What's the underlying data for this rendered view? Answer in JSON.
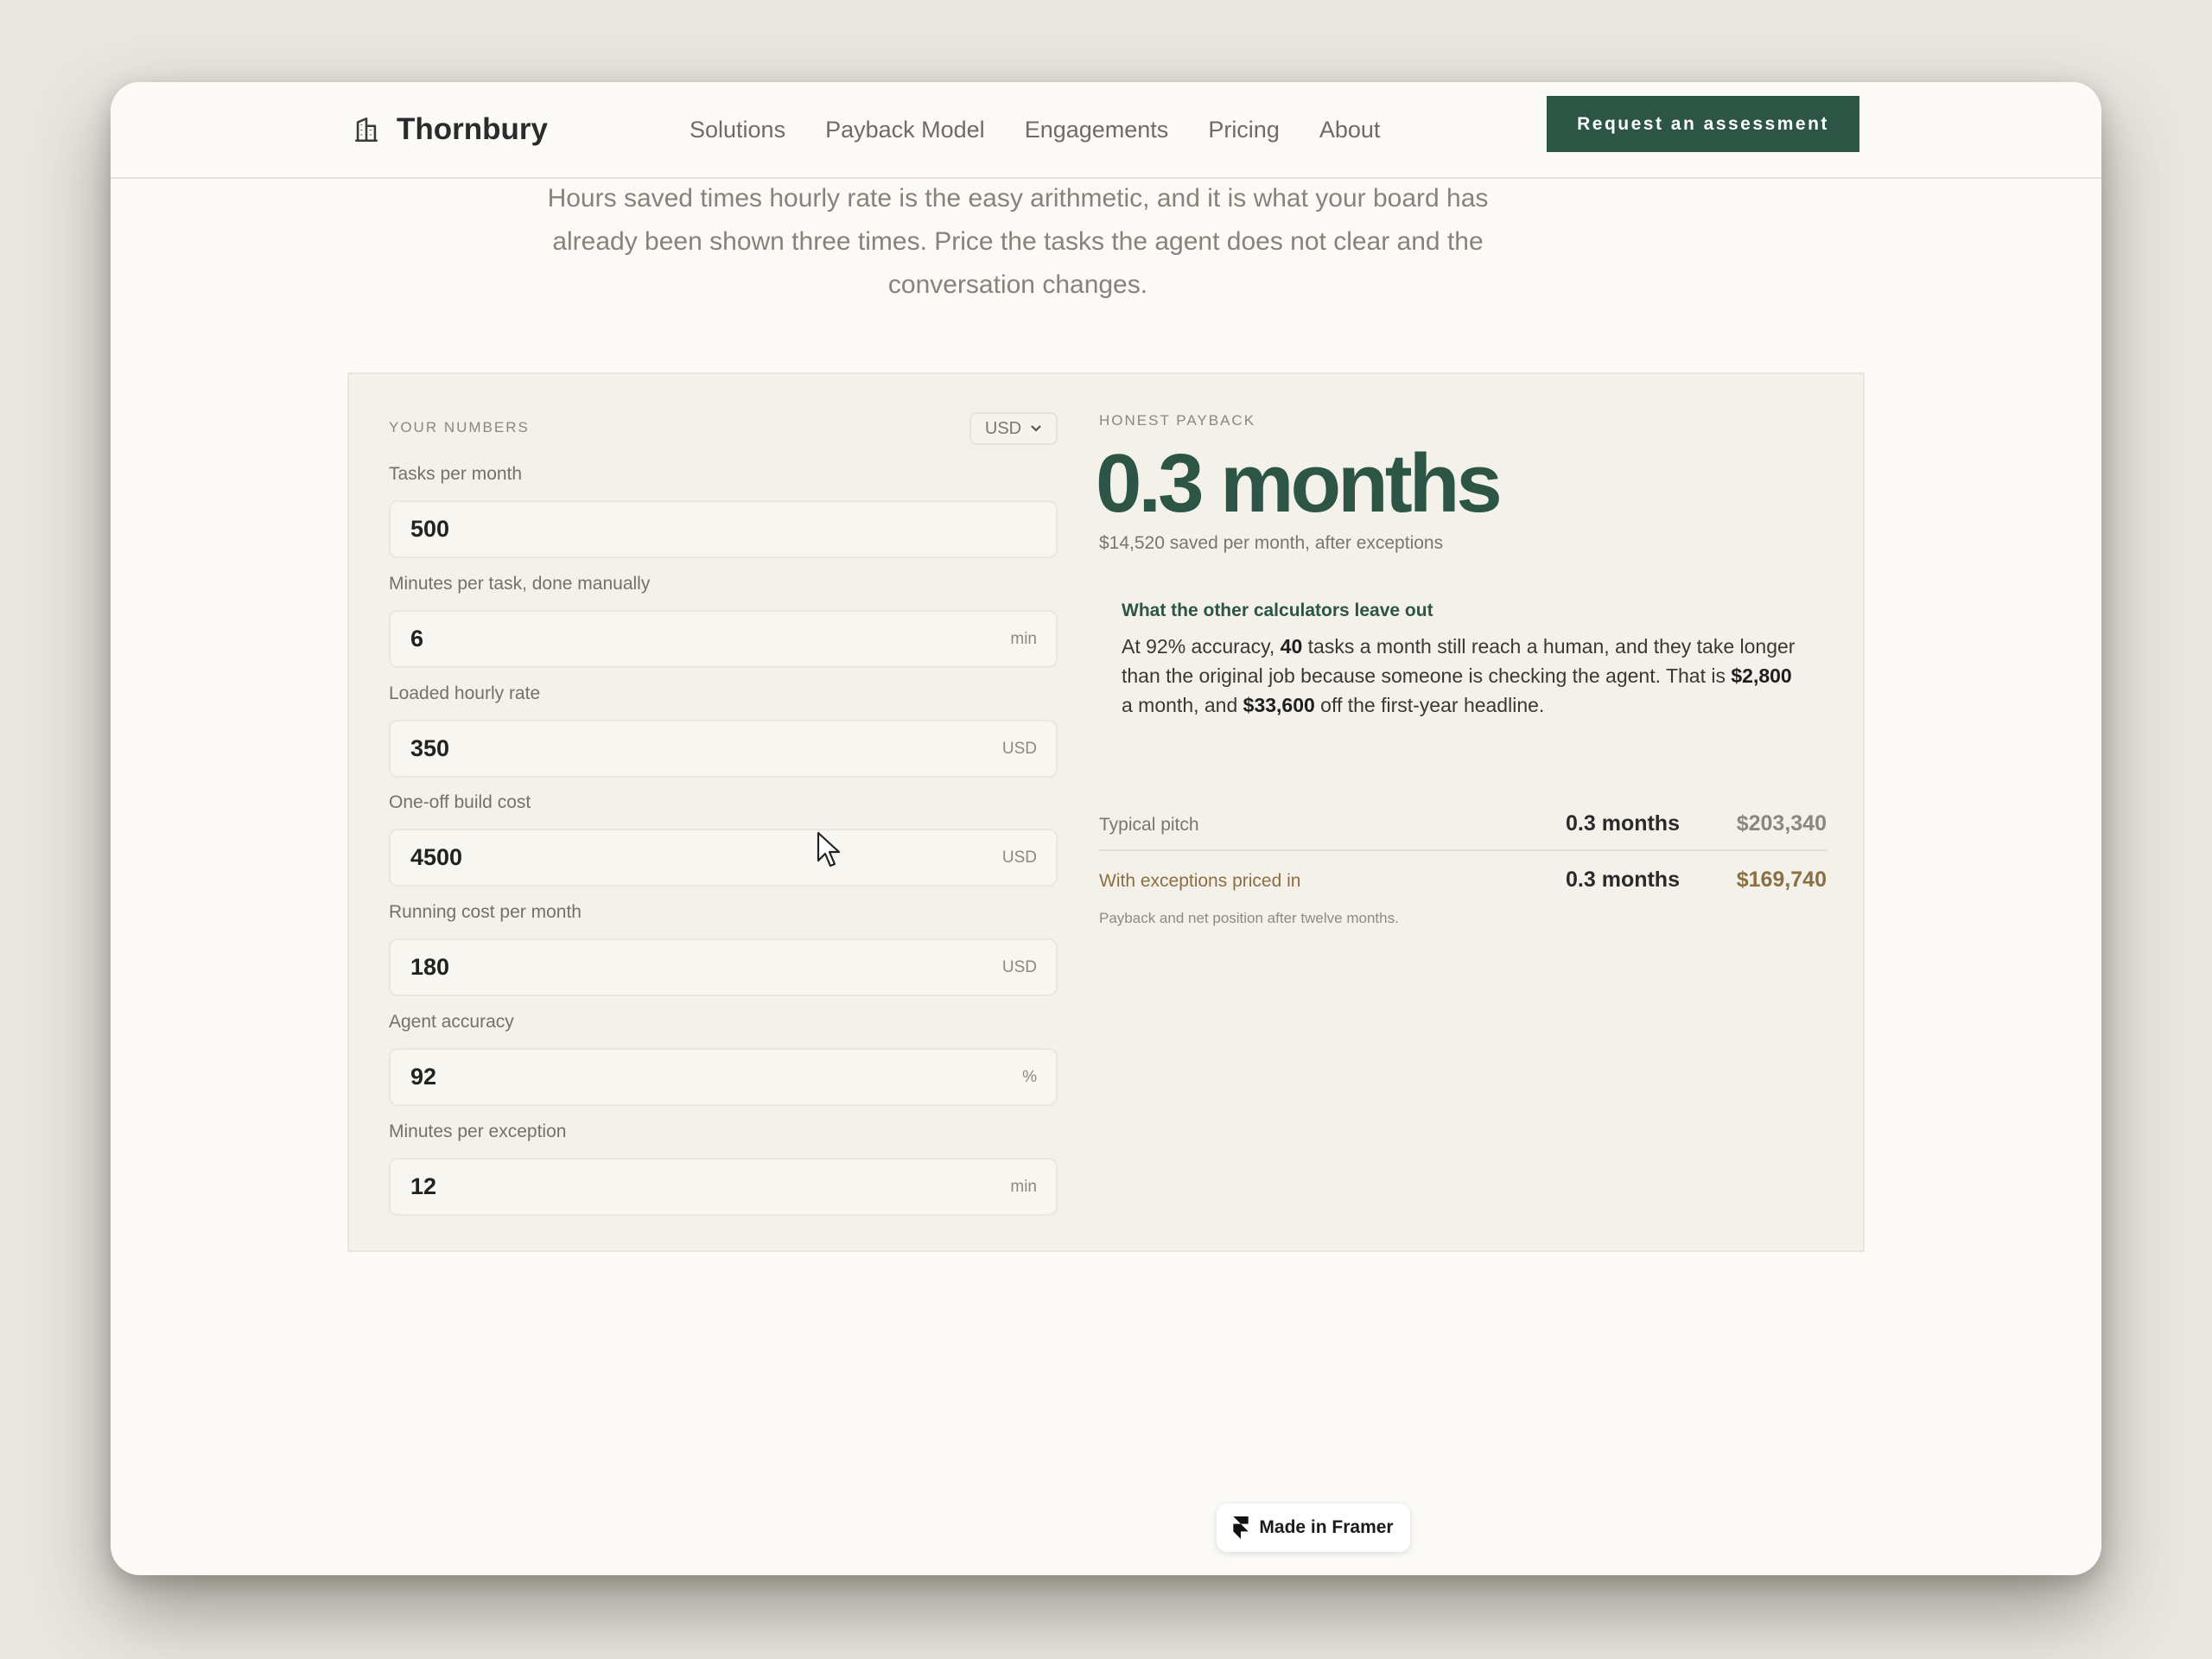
{
  "brand": {
    "name": "Thornbury",
    "icon": "building-icon"
  },
  "nav": {
    "links": [
      "Solutions",
      "Payback Model",
      "Engagements",
      "Pricing",
      "About"
    ],
    "cta": "Request an assessment"
  },
  "intro": "Hours saved times hourly rate is the easy arithmetic, and it is what your board has already been shown three times. Price the tasks the agent does not clear and the conversation changes.",
  "inputs": {
    "label": "YOUR NUMBERS",
    "currency": "USD",
    "fields": [
      {
        "label": "Tasks per month",
        "value": "500",
        "unit": ""
      },
      {
        "label": "Minutes per task, done manually",
        "value": "6",
        "unit": "min"
      },
      {
        "label": "Loaded hourly rate",
        "value": "350",
        "unit": "USD"
      },
      {
        "label": "One-off build cost",
        "value": "4500",
        "unit": "USD"
      },
      {
        "label": "Running cost per month",
        "value": "180",
        "unit": "USD"
      },
      {
        "label": "Agent accuracy",
        "value": "92",
        "unit": "%"
      },
      {
        "label": "Minutes per exception",
        "value": "12",
        "unit": "min"
      }
    ]
  },
  "result": {
    "label": "HONEST PAYBACK",
    "headline": "0.3 months",
    "saved": "$14,520 saved per month, after exceptions",
    "callout": {
      "title": "What the other calculators leave out",
      "p1": "At 92% accuracy, ",
      "b1": "40",
      "p2": " tasks a month still reach a human, and they take longer than the original job because someone is checking the agent. That is ",
      "b2": "$2,800",
      "p3": " a month, and ",
      "b3": "$33,600",
      "p4": " off the first-year headline."
    },
    "rows": [
      {
        "label": "Typical pitch",
        "months": "0.3 months",
        "amount": "$203,340"
      },
      {
        "label": "With exceptions priced in",
        "months": "0.3 months",
        "amount": "$169,740"
      }
    ],
    "footnote": "Payback and net position after twelve months."
  },
  "badge": {
    "text": "Made in Framer",
    "icon": "framer-logo-icon"
  },
  "colors": {
    "accent": "#2c5545",
    "gold": "#8a6f43",
    "background": "#e9e7e0"
  }
}
